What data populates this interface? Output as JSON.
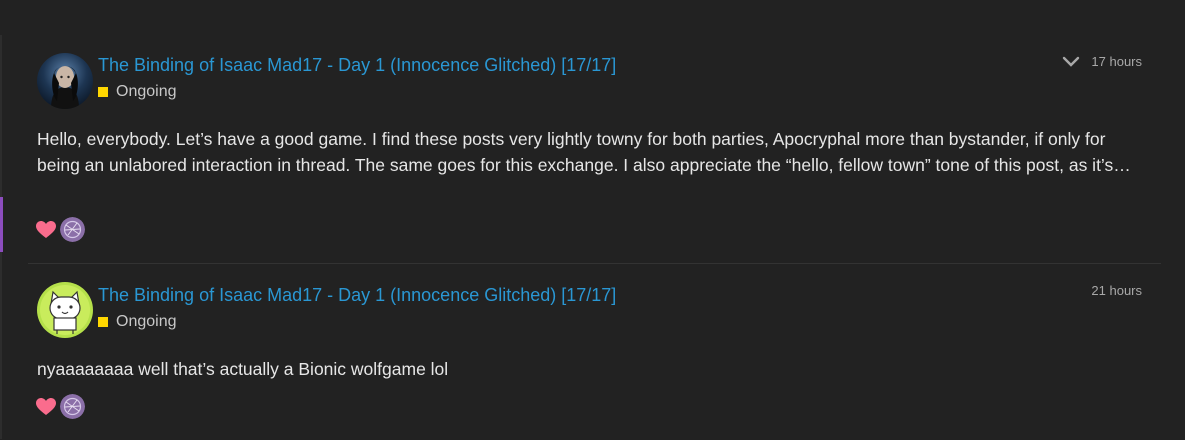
{
  "posts": [
    {
      "topic_title": "The Binding of Isaac Mad17 - Day 1 (Innocence Glitched) [17/17]",
      "category": "Ongoing",
      "category_color": "#ffd700",
      "time": "17 hours",
      "excerpt": "Hello, everybody. Let’s have a good game. I find these posts very lightly towny for both parties, Apocryphal more than bystander, if only for being an unlabored interaction in thread. The same goes for this exchange. I also appreciate the “hello, fellow town” tone of this post, as it’s…",
      "avatar_icon": "dark-portrait-avatar",
      "has_expand_icon": true
    },
    {
      "topic_title": "The Binding of Isaac Mad17 - Day 1 (Innocence Glitched) [17/17]",
      "category": "Ongoing",
      "category_color": "#ffd700",
      "time": "21 hours",
      "excerpt": "nyaaaaaaaa well that’s actually a Bionic wolfgame lol",
      "avatar_icon": "cat-avatar",
      "has_expand_icon": false
    }
  ],
  "colors": {
    "link": "#2a97d3",
    "heart": "#fa6c8d",
    "accent_rail": "#8c4dbe",
    "background": "#222222"
  },
  "icons": [
    "chevron-down-icon",
    "heart-icon",
    "reaction-avatar"
  ]
}
